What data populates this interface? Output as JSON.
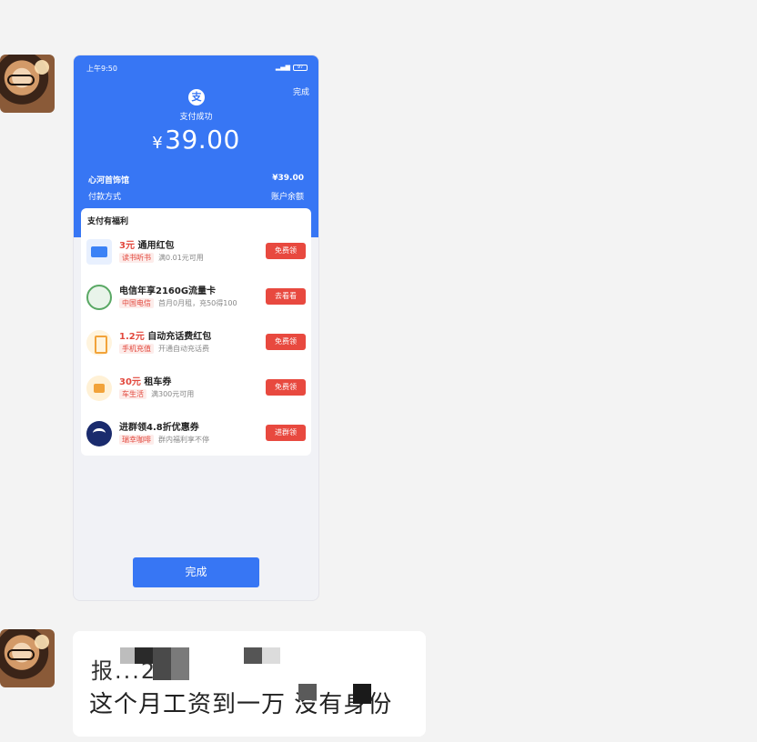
{
  "status_bar": {
    "time": "上午9:50",
    "battery": "97"
  },
  "header": {
    "done_top": "完成",
    "icon_char": "支",
    "pay_status": "支付成功",
    "currency": "¥",
    "amount": "39.00",
    "merchant": "心河首饰馆",
    "merchant_amount": "¥39.00",
    "pay_method_label": "付款方式",
    "pay_method_value": "账户余额"
  },
  "benefits": {
    "title": "支付有福利",
    "items": [
      {
        "highlight": "3元",
        "title": "通用红包",
        "badge": "读书听书",
        "sub": "满0.01元可用",
        "button": "免费领",
        "icon": "book-icon"
      },
      {
        "highlight": "",
        "title": "电信年享2160G流量卡",
        "badge": "中国电信",
        "sub": "首月0月租，充50得100",
        "button": "去看看",
        "icon": "sim-card-icon"
      },
      {
        "highlight": "1.2元",
        "title": "自动充话费红包",
        "badge": "手机充值",
        "sub": "开通自动充话费",
        "button": "免费领",
        "icon": "phone-icon"
      },
      {
        "highlight": "30元",
        "title": "租车券",
        "badge": "车生活",
        "sub": "满300元可用",
        "button": "免费领",
        "icon": "car-icon"
      },
      {
        "highlight": "",
        "title": "进群领4.8折优惠券",
        "badge": "瑞幸咖啡",
        "sub": "群内福利享不停",
        "button": "进群领",
        "icon": "luckin-icon"
      }
    ]
  },
  "bottom_button": "完成",
  "chat_message": {
    "line1": "报...27",
    "line2": "这个月工资到一万 没有身份"
  }
}
